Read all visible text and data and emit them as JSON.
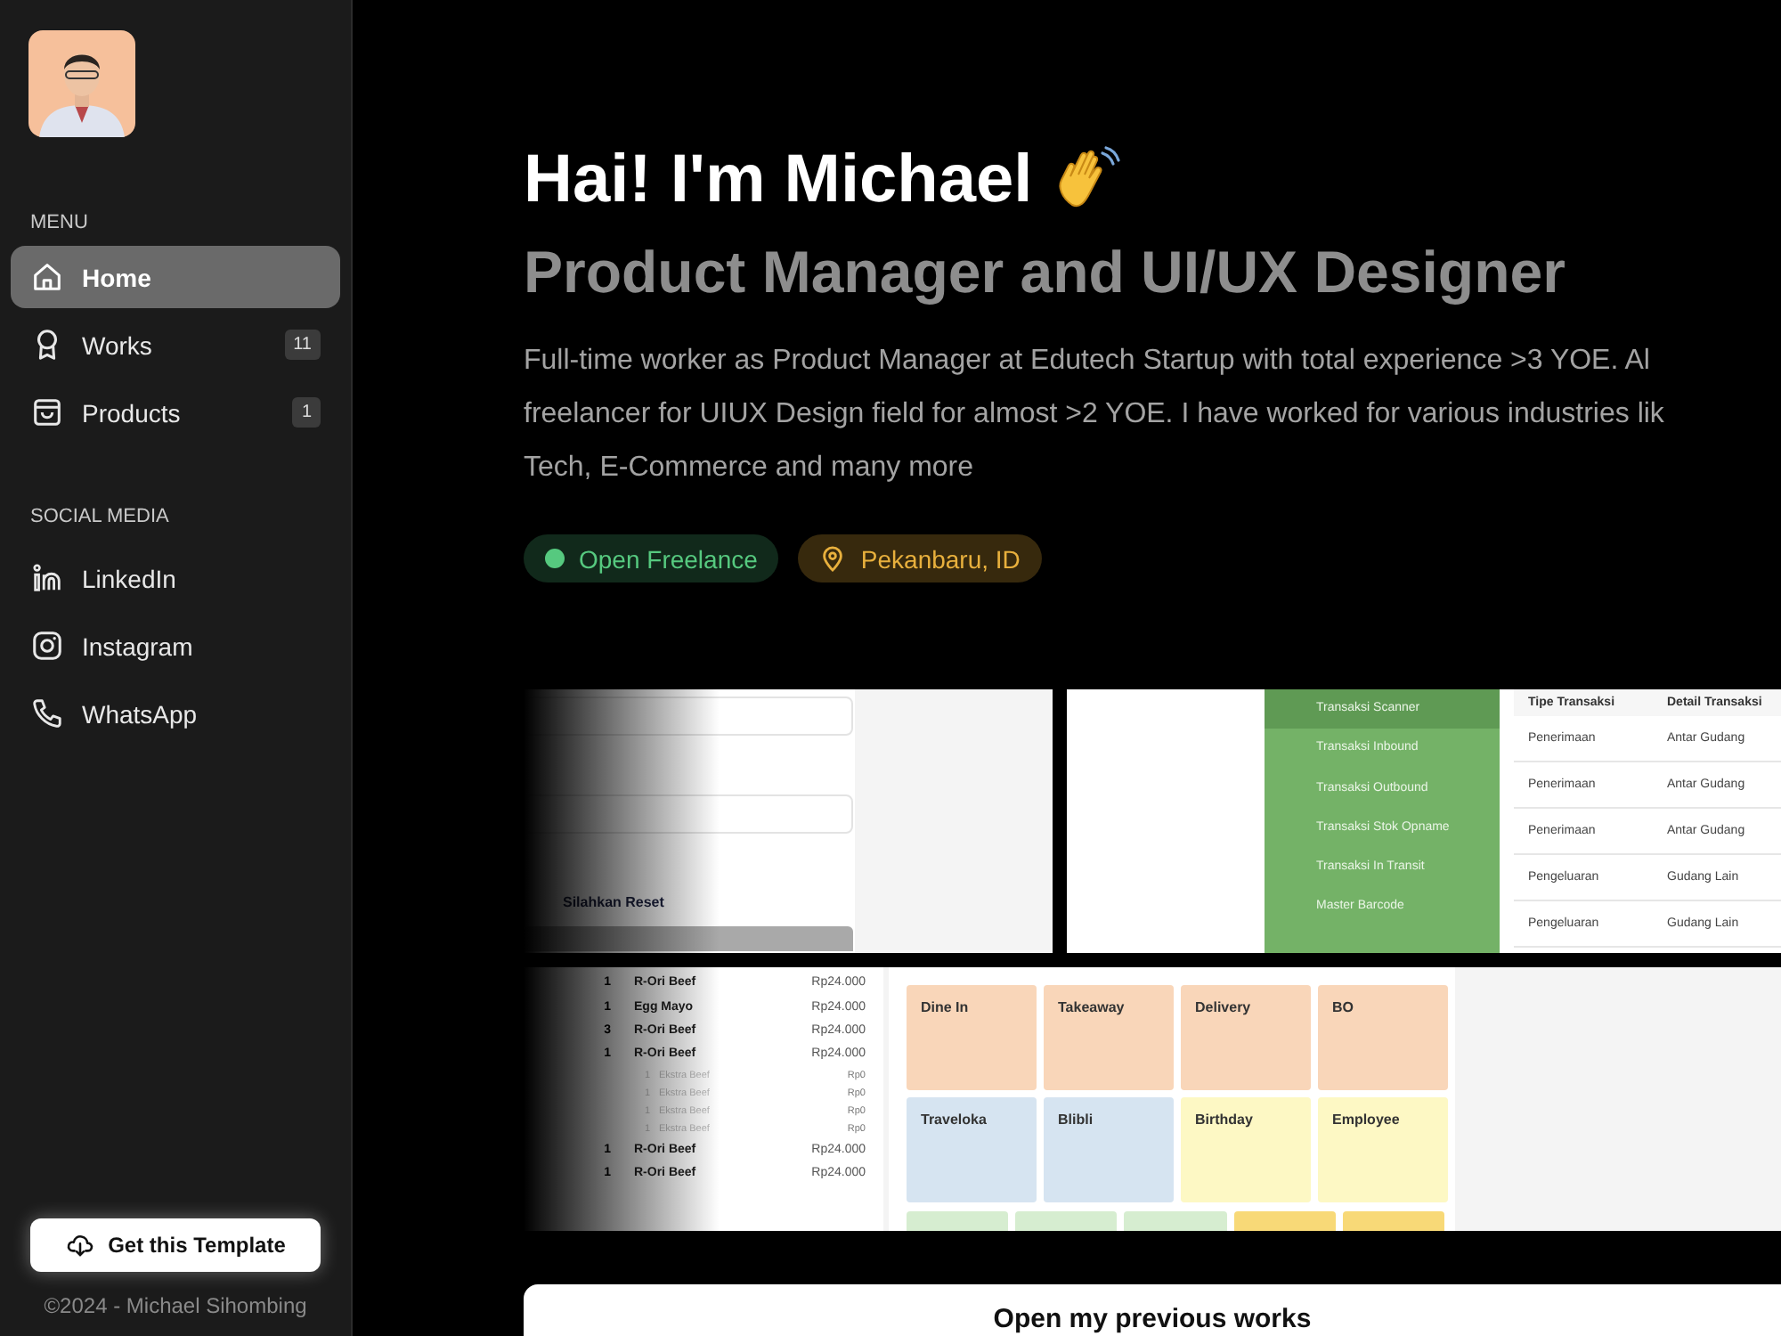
{
  "sidebar": {
    "menu_heading": "MENU",
    "menu": [
      {
        "label": "Home",
        "selected": true
      },
      {
        "label": "Works",
        "badge": "11",
        "selected": false
      },
      {
        "label": "Products",
        "badge": "1",
        "selected": false
      }
    ],
    "social_heading": "SOCIAL MEDIA",
    "social": [
      {
        "label": "LinkedIn"
      },
      {
        "label": "Instagram"
      },
      {
        "label": "WhatsApp"
      }
    ],
    "template_button": "Get this Template",
    "copyright": "©2024 - Michael Sihombing"
  },
  "hero": {
    "greeting": "Hai! I'm Michael",
    "role": "Product Manager and UI/UX Designer",
    "bio": [
      "Full-time worker as Product Manager at Edutech Startup with total experience >3 YOE. Al",
      "freelancer for UIUX Design field for almost >2 YOE. I have worked for various industries lik",
      "Tech, E-Commerce and many more"
    ],
    "tags": [
      {
        "label": "Open Freelance",
        "kind": "status"
      },
      {
        "label": "Pekanbaru, ID",
        "kind": "location"
      }
    ]
  },
  "gallery": {
    "login": {
      "link": "Silahkan Reset"
    },
    "inventory": {
      "menu": [
        {
          "label": "Transaksi Scanner",
          "selected": true
        },
        {
          "label": "Transaksi Inbound",
          "selected": false
        },
        {
          "label": "Transaksi Outbound",
          "selected": false
        },
        {
          "label": "Transaksi Stok Opname",
          "selected": false
        },
        {
          "label": "Transaksi In Transit",
          "selected": false
        },
        {
          "label": "Master Barcode",
          "selected": false
        }
      ],
      "columns": [
        "Tipe Transaksi",
        "Detail Transaksi"
      ],
      "rows": [
        [
          "Penerimaan",
          "Antar Gudang"
        ],
        [
          "Penerimaan",
          "Antar Gudang"
        ],
        [
          "Penerimaan",
          "Antar Gudang"
        ],
        [
          "Pengeluaran",
          "Gudang Lain"
        ],
        [
          "Pengeluaran",
          "Gudang Lain"
        ]
      ]
    },
    "pos": {
      "orders": [
        {
          "qty": "1",
          "name": "R-Ori Beef",
          "price": "Rp24.000",
          "kind": "item"
        },
        {
          "qty": "1",
          "name": "Egg Mayo",
          "price": "Rp24.000",
          "kind": "item"
        },
        {
          "qty": "3",
          "name": "R-Ori Beef",
          "price": "Rp24.000",
          "kind": "item"
        },
        {
          "qty": "1",
          "name": "R-Ori Beef",
          "price": "Rp24.000",
          "kind": "item"
        },
        {
          "qty": "1",
          "name": "Ekstra Beef",
          "price": "Rp0",
          "kind": "extra"
        },
        {
          "qty": "1",
          "name": "Ekstra Beef",
          "price": "Rp0",
          "kind": "extra"
        },
        {
          "qty": "1",
          "name": "Ekstra Beef",
          "price": "Rp0",
          "kind": "extra"
        },
        {
          "qty": "1",
          "name": "Ekstra Beef",
          "price": "Rp0",
          "kind": "extra"
        },
        {
          "qty": "1",
          "name": "R-Ori Beef",
          "price": "Rp24.000",
          "kind": "item"
        },
        {
          "qty": "1",
          "name": "R-Ori Beef",
          "price": "Rp24.000",
          "kind": "item"
        }
      ],
      "types": [
        {
          "label": "Dine In",
          "color": "#f9d6b9"
        },
        {
          "label": "Takeaway",
          "color": "#f9d6b9"
        },
        {
          "label": "Delivery",
          "color": "#f9d6b9"
        },
        {
          "label": "BO",
          "color": "#f9d6b9"
        },
        {
          "label": "Traveloka",
          "color": "#d6e4f1"
        },
        {
          "label": "Blibli",
          "color": "#d6e4f1"
        },
        {
          "label": "Birthday",
          "color": "#fdf8c4"
        },
        {
          "label": "Employee",
          "color": "#fdf8c4"
        }
      ],
      "more_types": [
        {
          "color": "#d6edd0"
        },
        {
          "color": "#d6edd0"
        },
        {
          "color": "#d6edd0"
        },
        {
          "color": "#f8d977"
        },
        {
          "color": "#f8d977"
        }
      ]
    }
  },
  "cta": "Open my previous works"
}
